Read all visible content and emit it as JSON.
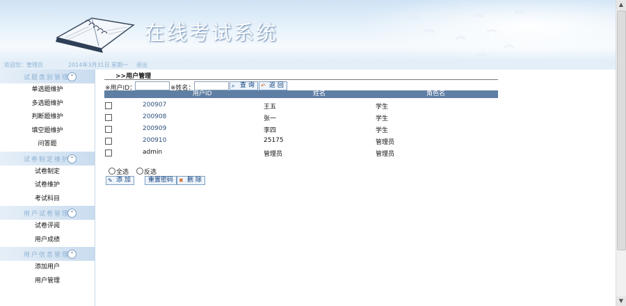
{
  "header": {
    "title": "在线考试系统"
  },
  "infobar": {
    "user": "欢迎您：管理员",
    "date": "2014年3月31日 星期一",
    "logout": "退出"
  },
  "sidebar": {
    "groups": [
      {
        "title": "试题类别管理",
        "items": [
          "单选题维护",
          "多选题维护",
          "判断题维护",
          "填空题维护",
          "问答题"
        ]
      },
      {
        "title": "试卷制定维护",
        "items": [
          "试卷制定",
          "试卷维护",
          "考试科目"
        ]
      },
      {
        "title": "用户试卷管理",
        "items": [
          "试卷评阅",
          "用户成绩"
        ]
      },
      {
        "title": "用户信息管理",
        "items": [
          "添加用户",
          "用户管理"
        ]
      }
    ]
  },
  "main": {
    "breadcrumb": ">>用户管理",
    "search": {
      "userid_label": "※用户ID：",
      "userid_value": "",
      "name_label": "※姓名：",
      "name_value": "",
      "query_btn": "查 询",
      "back_btn": "返 回"
    },
    "table": {
      "headers": [
        "用户ID",
        "姓名",
        "角色名"
      ],
      "rows": [
        {
          "id": "200907",
          "name": "王五",
          "role": "学生"
        },
        {
          "id": "200908",
          "name": "张一",
          "role": "学生"
        },
        {
          "id": "200909",
          "name": "李四",
          "role": "学生"
        },
        {
          "id": "200910",
          "name": "25175",
          "role": "管理员"
        },
        {
          "id": "admin",
          "name": "管理员",
          "role": "管理员"
        }
      ]
    },
    "select_all": "全选",
    "select_invert": "反选",
    "actions": {
      "add": "添 加",
      "reset_pwd": "重置密码",
      "delete": "删 除"
    }
  },
  "colors": {
    "table_header": "#5f7ea3",
    "sidebar_group": "#c9dcef",
    "accent_blue": "#2d4f7c"
  }
}
